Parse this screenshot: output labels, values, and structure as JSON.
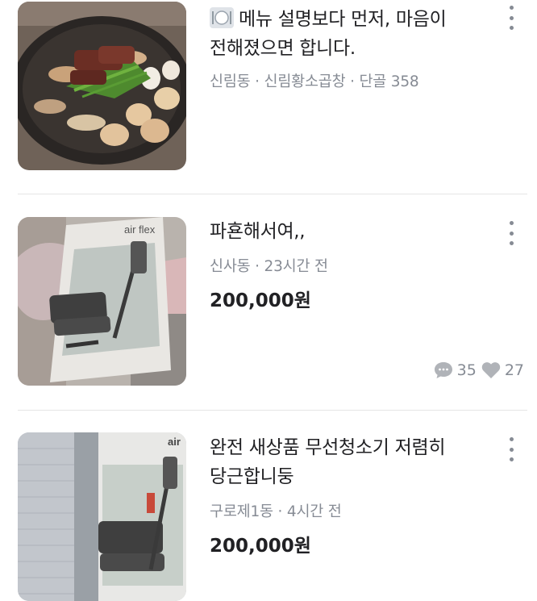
{
  "items": [
    {
      "title_icon": "plate-icon",
      "title": "메뉴 설명보다 먼저, 마음이 전해졌으면 합니다.",
      "meta": "신림동 · 신림황소곱창 · 단골 358",
      "image": "grilled-tripe-photo"
    },
    {
      "title": "파횬해서여,,",
      "meta": "신사동 · 23시간 전",
      "price": "200,000원",
      "chat_count": "35",
      "like_count": "27",
      "image": "vacuum-box-photo",
      "image_brand": "air flex"
    },
    {
      "title": "완전 새상품 무선청소기 저렴히 당근합니둥",
      "meta": "구로제1동 · 4시간 전",
      "price": "200,000원",
      "image": "vacuum-box-photo",
      "image_brand": "air"
    }
  ],
  "colors": {
    "text": "#212124",
    "meta": "#868b94",
    "divider": "#e6e6e6"
  }
}
